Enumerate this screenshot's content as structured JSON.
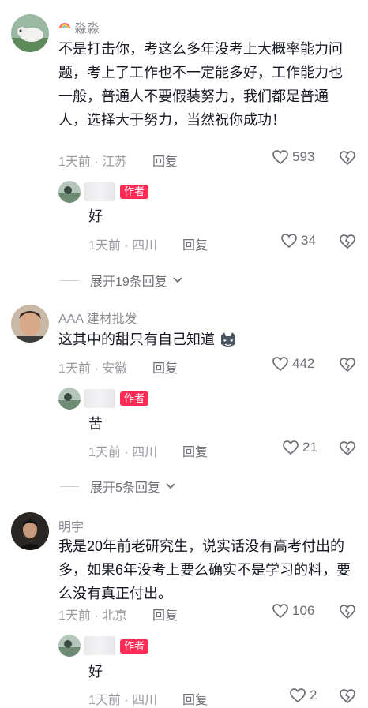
{
  "comments": [
    {
      "username": "淼淼",
      "text": "不是打击你，考这么多年没考上大概率能力问题，考上了工作也不一定能多好，工作能力也一般，普通人不要假装努力，我们都是普通人，选择大于努力，当然祝你成功！",
      "time": "1天前 · 江苏",
      "reply_label": "回复",
      "likes": "593",
      "reply": {
        "badge": "作者",
        "text": "好",
        "time": "1天前 · 四川",
        "reply_label": "回复",
        "likes": "34"
      },
      "expand": "展开19条回复"
    },
    {
      "username": "AAA 建材批发",
      "text": "这其中的甜只有自己知道",
      "time": "1天前 · 安徽",
      "reply_label": "回复",
      "likes": "442",
      "reply": {
        "badge": "作者",
        "text": "苦",
        "time": "1天前 · 四川",
        "reply_label": "回复",
        "likes": "21"
      },
      "expand": "展开5条回复"
    },
    {
      "username": "明宇",
      "text": "我是20年前老研究生，说实话没有高考付出的多，如果6年没考上要么确实不是学习的料，要么没有真正付出。",
      "time": "1天前 · 北京",
      "reply_label": "回复",
      "likes": "106",
      "reply": {
        "badge": "作者",
        "text": "好",
        "time": "1天前 · 四川",
        "reply_label": "回复",
        "likes": "2"
      }
    }
  ],
  "icons": {
    "like": "heart-outline-icon",
    "dislike": "broken-heart-icon",
    "expand": "chevron-down-icon",
    "username_prefix": "rainbow-icon",
    "emoji": "cat-face-emoji"
  },
  "colors": {
    "author_badge": "#fe2c55",
    "text": "#161823",
    "muted": "#9b9ca2"
  }
}
